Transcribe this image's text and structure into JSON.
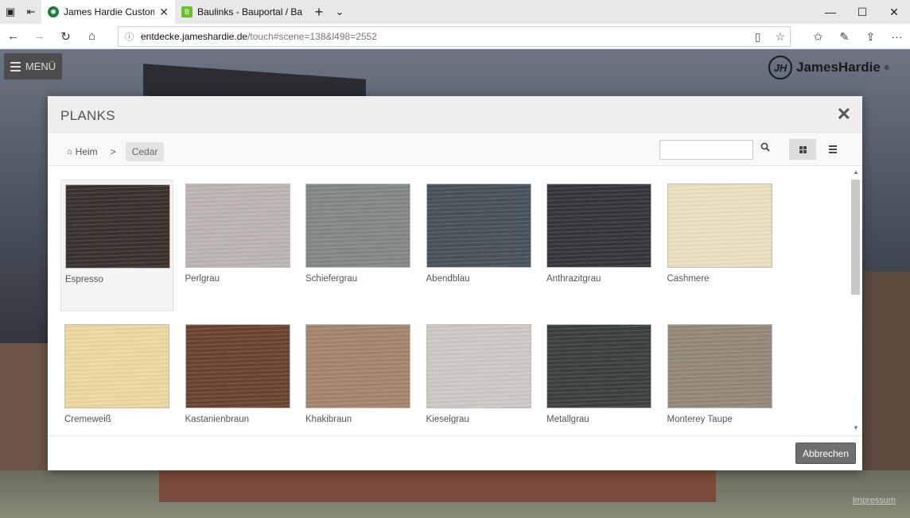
{
  "browser": {
    "tabs": [
      {
        "title": "James Hardie Customiz",
        "active": true,
        "favicon_color": "#1e7d3a"
      },
      {
        "title": "Baulinks - Bauportal / Baum",
        "active": false,
        "favicon_color": "#6cbf2b",
        "favicon_letter": "B"
      }
    ],
    "url_host": "entdecke.jameshardie.de",
    "url_path": "/touch#scene=138&l498=2552"
  },
  "page": {
    "menu_label": "MENÜ",
    "brand": "JamesHardie",
    "brand_mark": "JH",
    "brand_reg": "®",
    "impressum": "Impressum"
  },
  "modal": {
    "title": "PLANKS",
    "breadcrumb_home": "Heim",
    "breadcrumb_sep": ">",
    "breadcrumb_current": "Cedar",
    "search_value": "",
    "cancel_label": "Abbrechen",
    "swatches": [
      {
        "label": "Espresso",
        "color": "#3a322d",
        "selected": true
      },
      {
        "label": "Perlgrau",
        "color": "#bdb6b4",
        "selected": false
      },
      {
        "label": "Schiefergrau",
        "color": "#858985",
        "selected": false
      },
      {
        "label": "Abendblau",
        "color": "#4a535b",
        "selected": false
      },
      {
        "label": "Anthrazitgrau",
        "color": "#35373c",
        "selected": false
      },
      {
        "label": "Cashmere",
        "color": "#ede2c0",
        "selected": false
      },
      {
        "label": "Cremeweiß",
        "color": "#f0d9a1",
        "selected": false
      },
      {
        "label": "Kastanienbraun",
        "color": "#6a4530",
        "selected": false
      },
      {
        "label": "Khakibraun",
        "color": "#a6876d",
        "selected": false
      },
      {
        "label": "Kieselgrau",
        "color": "#d0cbc5",
        "selected": false
      },
      {
        "label": "Metallgrau",
        "color": "#3c4040",
        "selected": false
      },
      {
        "label": "Monterey Taupe",
        "color": "#958a7a",
        "selected": false
      }
    ]
  }
}
